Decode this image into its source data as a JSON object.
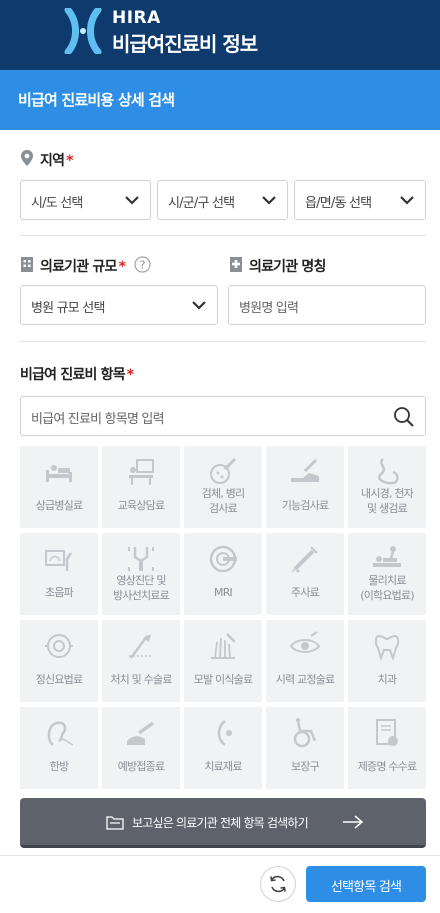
{
  "header": {
    "logo_en": "HIRA",
    "logo_ko": "비급여진료비 정보"
  },
  "page_title": "비급여 진료비용 상세 검색",
  "region": {
    "label": "지역",
    "required": "*",
    "selects": [
      "시/도 선택",
      "시/군/구 선택",
      "읍/면/동 선택"
    ]
  },
  "institution": {
    "scale_label": "의료기관 규모",
    "scale_required": "*",
    "scale_placeholder": "병원 규모 선택",
    "name_label": "의료기관 명칭",
    "name_placeholder": "병원명 입력"
  },
  "items": {
    "label": "비급여 진료비 항목",
    "required": "*",
    "search_placeholder": "비급여 진료비 항목명 입력",
    "tiles": [
      {
        "label": "상급병실료",
        "icon": "hospital-bed-icon"
      },
      {
        "label": "교육상담료",
        "icon": "counseling-icon"
      },
      {
        "label": "검체, 병리\n검사료",
        "icon": "specimen-icon"
      },
      {
        "label": "기능검사료",
        "icon": "function-test-icon"
      },
      {
        "label": "내시경, 천자\n및 생검료",
        "icon": "endoscope-icon"
      },
      {
        "label": "초음파",
        "icon": "ultrasound-icon"
      },
      {
        "label": "영상진단 및\n방사선치료료",
        "icon": "xray-icon"
      },
      {
        "label": "MRI",
        "icon": "mri-icon"
      },
      {
        "label": "주사료",
        "icon": "syringe-icon"
      },
      {
        "label": "물리치료\n(이학요법료)",
        "icon": "physical-therapy-icon"
      },
      {
        "label": "정신요법료",
        "icon": "brain-icon"
      },
      {
        "label": "처치 및 수술료",
        "icon": "surgery-icon"
      },
      {
        "label": "모발 이식술료",
        "icon": "hair-transplant-icon"
      },
      {
        "label": "시력 교정술료",
        "icon": "eye-icon"
      },
      {
        "label": "치과",
        "icon": "tooth-icon"
      },
      {
        "label": "한방",
        "icon": "acupuncture-icon"
      },
      {
        "label": "예방접종료",
        "icon": "vaccine-icon"
      },
      {
        "label": "치료재료",
        "icon": "lens-icon"
      },
      {
        "label": "보장구",
        "icon": "wheelchair-icon"
      },
      {
        "label": "제증명 수수료",
        "icon": "certificate-icon"
      }
    ]
  },
  "all_search_button": "보고싶은 의료기관 전체 항목 검색하기",
  "submit_button": "선택항목 검색",
  "colors": {
    "header": "#0f3a6e",
    "accent": "#2e8ee6",
    "tile_bg": "#f1f2f4",
    "dark_button": "#5d626b"
  }
}
